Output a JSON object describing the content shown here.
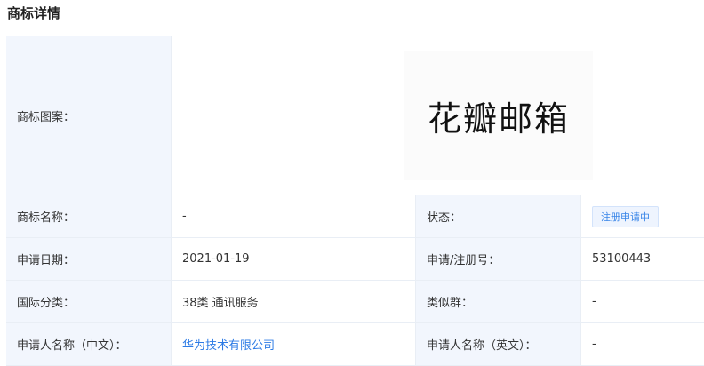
{
  "title": "商标详情",
  "rows": {
    "image": {
      "label": "商标图案：",
      "logo_text": "花瓣邮箱"
    },
    "name": {
      "label": "商标名称：",
      "value": "-",
      "label2": "状态：",
      "status_badge": "注册申请中"
    },
    "date": {
      "label": "申请日期：",
      "value": "2021-01-19",
      "label2": "申请/注册号：",
      "value2": "53100443"
    },
    "class": {
      "label": "国际分类：",
      "value": "38类 通讯服务",
      "label2": "类似群：",
      "value2": "-"
    },
    "applicant": {
      "label": "申请人名称（中文）：",
      "value": "华为技术有限公司",
      "label2": "申请人名称（英文）：",
      "value2": "-"
    }
  },
  "colors": {
    "label_bg": "#f2f6fd",
    "link": "#2d7be5",
    "badge_text": "#3a86e8",
    "badge_bg": "#eef4fe",
    "border": "#e9eef5"
  }
}
